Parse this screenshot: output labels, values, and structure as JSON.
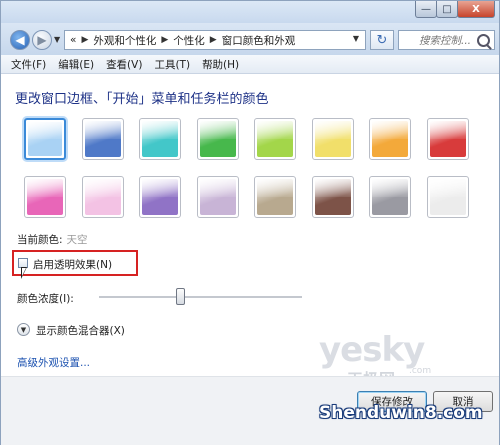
{
  "window": {
    "caption_buttons": {
      "minimize": "—",
      "maximize": "□",
      "close": "X"
    }
  },
  "address": {
    "back_icon": "arrow-left-icon",
    "prefix": "«",
    "crumbs": [
      "外观和个性化",
      "个性化",
      "窗口颜色和外观"
    ],
    "search_placeholder": "搜索控制..."
  },
  "menu": [
    "文件(F)",
    "编辑(E)",
    "查看(V)",
    "工具(T)",
    "帮助(H)"
  ],
  "heading": "更改窗口边框、「开始」菜单和任务栏的颜色",
  "swatches": [
    {
      "name": "sky",
      "color": "#a9d2f4",
      "selected": true
    },
    {
      "name": "twilight",
      "color": "#4f79c8"
    },
    {
      "name": "sea",
      "color": "#43c7c9"
    },
    {
      "name": "leaf",
      "color": "#47b84c"
    },
    {
      "name": "lime",
      "color": "#a3d64a"
    },
    {
      "name": "lemon",
      "color": "#f1df6a"
    },
    {
      "name": "pumpkin",
      "color": "#f3a93a"
    },
    {
      "name": "ruby",
      "color": "#d83b3b"
    },
    {
      "name": "fuchsia",
      "color": "#e866b8"
    },
    {
      "name": "blush",
      "color": "#f3c2e4"
    },
    {
      "name": "violet",
      "color": "#9073c6"
    },
    {
      "name": "lavender",
      "color": "#c8b4d6"
    },
    {
      "name": "taupe",
      "color": "#b8a98f"
    },
    {
      "name": "chocolate",
      "color": "#7d5348"
    },
    {
      "name": "slate",
      "color": "#9a9aa2"
    },
    {
      "name": "frost",
      "color": "#ececec"
    }
  ],
  "current_color_label": "当前颜色:",
  "current_color_value": "天空",
  "transparency_label": "启用透明效果(N)",
  "transparency_checked": false,
  "intensity_label": "颜色浓度(I):",
  "intensity_level": 0.4,
  "mixer_label": "显示颜色混合器(X)",
  "advanced_link": "高级外观设置...",
  "buttons": {
    "save": "保存修改",
    "cancel": "取消"
  },
  "overlay": {
    "logo_main": "yesky",
    "logo_sub": "天极网",
    "logo_com": ".com",
    "watermark": "Shenduwin8.com"
  }
}
